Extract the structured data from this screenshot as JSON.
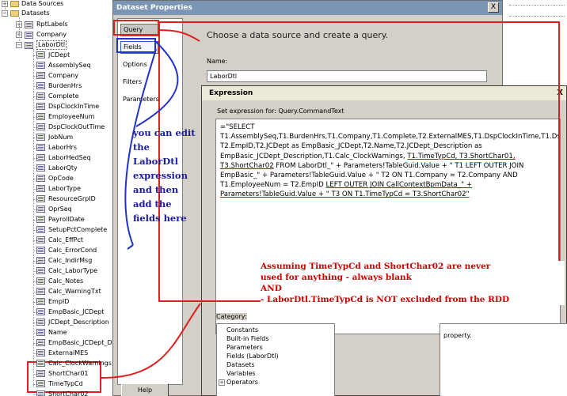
{
  "tree": {
    "root_items": [
      {
        "label": "Data Sources"
      },
      {
        "label": "Datasets"
      }
    ],
    "datasets": [
      {
        "label": "RptLabels"
      },
      {
        "label": "Company"
      },
      {
        "label": "LaborDtl"
      }
    ],
    "fields": [
      "JCDept",
      "AssemblySeq",
      "Company",
      "BurdenHrs",
      "Complete",
      "DspClockInTime",
      "EmployeeNum",
      "DspClockOutTime",
      "JobNum",
      "LaborHrs",
      "LaborHedSeq",
      "LaborQty",
      "OpCode",
      "LaborType",
      "ResourceGrpID",
      "OprSeq",
      "PayrollDate",
      "SetupPctComplete",
      "Calc_EffPct",
      "Calc_ErrorCond",
      "Calc_IndirMsg",
      "Calc_LaborType",
      "Calc_Notes",
      "Calc_WarningTxt",
      "EmpID",
      "EmpBasic_JCDept",
      "JCDept_Description",
      "Name",
      "EmpBasic_JCDept_D",
      "ExternalMES",
      "Calc_ClockWarnings",
      "ShortChar01",
      "TimeTypCd",
      "ShortChar02"
    ]
  },
  "dialog": {
    "title": "Dataset Properties",
    "close_glyph": "X",
    "nav": [
      "Query",
      "Fields",
      "Options",
      "Filters",
      "Parameters"
    ],
    "heading": "Choose a data source and create a query.",
    "name_label": "Name:",
    "name_value": "LaborDtl",
    "help_label": "Help"
  },
  "expression": {
    "title": "Expression",
    "close_glyph": "X",
    "caption": "Set expression for: Query.CommandText",
    "text_before": "=\"SELECT T1.AssemblySeq,T1.BurdenHrs,T1.Company,T1.Complete,T2.ExternalMES,T1.DspClockInTime,T1.DspClockOutTime,T1.EmployeeNum,T1.JCDept,T1.JobNum,T1.LaborHedSeq,T1.LaborHrs,T1.LaborQty,T1.LaborType,T1.OpCode,T1.OprSeq,T1.PayrollDate,T1.ResourceGrpID,T1.SetupPctComplete,T1.Calc_EffPct,T1.Calc_ErrorCond,T1.Calc_IndirMsg,T1.Calc_LaborType,T1.Calc_Notes,T1.Calc_WarningTxt,T1.JCDept_Description, T2.EmpID,T2.JCDept as EmpBasic_JCDept,T2.Name,T2.JCDept_Description as EmpBasic_JCDept_Description,T1.Calc_ClockWarnings, ",
    "text_hl1": "T1.TimeTypCd, T3.ShortChar01, T3.ShortChar02",
    "text_mid": " FROM LaborDtl_\" + Parameters!TableGuid.Value + \" T1  LEFT OUTER JOIN EmpBasic_\" + Parameters!TableGuid.Value + \" T2 ON T1.Company = T2.Company AND T1.EmployeeNum = T2.EmpID ",
    "text_hl2": "LEFT OUTER JOIN CallContextBpmData_\" + Parameters!TableGuid.Value + \" T3 ON T1.TimeTypCd = T3.ShortChar02\"",
    "category_label": "Category:",
    "categories": [
      "Constants",
      "Built-in Fields",
      "Parameters",
      "Fields (LaborDtl)",
      "Datasets",
      "Variables",
      "Operators"
    ],
    "description_text": "property."
  },
  "annotations": {
    "blue_note": "you can edit the LaborDtl expression and then add the fields here",
    "red_line1": "Assuming TimeTypCd and ShortChar02 are never",
    "red_line2": "used for anything - always blank",
    "red_line3": "AND",
    "red_line4": "- LaborDtl.TimeTypCd is NOT excluded from the RDD"
  },
  "colors": {
    "annotation_red": "#e02020",
    "annotation_blue": "#2233cc",
    "title_bar": "#7a96b4"
  }
}
